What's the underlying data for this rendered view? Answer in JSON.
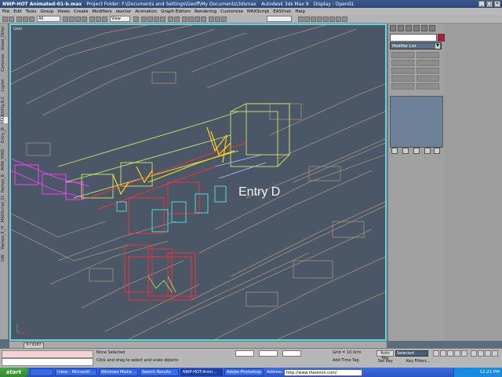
{
  "window": {
    "title": "NWP-HOT Animated-01-b.max",
    "project_folder": "Project Folder: F:\\Documents and Settings\\Geoff\\My Documents\\3dsmax",
    "app": "Autodesk 3ds Max 9",
    "display": "Display : OpenGL"
  },
  "menu": [
    "File",
    "Edit",
    "Tools",
    "Group",
    "Views",
    "Create",
    "Modifiers",
    "reactor",
    "Animation",
    "Graph Editors",
    "Rendering",
    "Customize",
    "MAXScript",
    "EASYnet",
    "Help"
  ],
  "toolbar": {
    "selection_filter": "All",
    "coord_system": "View"
  },
  "left_tabs": [
    "Views_Other",
    "Cameras",
    "Lights",
    "Utility.A.C",
    "MAX",
    "Entry_D",
    "AHW_HWD",
    "Ramps_B",
    "MAXScript_01",
    "Ramps_E_H",
    "GW"
  ],
  "viewport": {
    "label": "User",
    "annotation": "Entry D"
  },
  "command_panel": {
    "modifier_list": "Modifier List"
  },
  "time_slider": {
    "position": "0 / 4207"
  },
  "status": {
    "selection": "None Selected",
    "prompt": "Click and drag to select and scale objects",
    "grid": "Grid = 10.0cm",
    "add_time_tag": "Add Time Tag",
    "auto_key": "Auto Key",
    "auto_key_mode": "Selected",
    "set_key": "Set Key",
    "key_filters": "Key Filters..."
  },
  "taskbar": {
    "start": "start",
    "tasks": [
      "Inbox - Microsoft ...",
      "Windows Media ...",
      "Search Results",
      "NWP-HOT-Anim...",
      "Adobe Photoshop ..."
    ],
    "address_label": "Address",
    "address_url": "http://www.theonion.com/",
    "clock": "12:21 PM"
  },
  "colors": {
    "viewport_border": "#66d3e0",
    "entry_label": "#f1f1f1"
  }
}
